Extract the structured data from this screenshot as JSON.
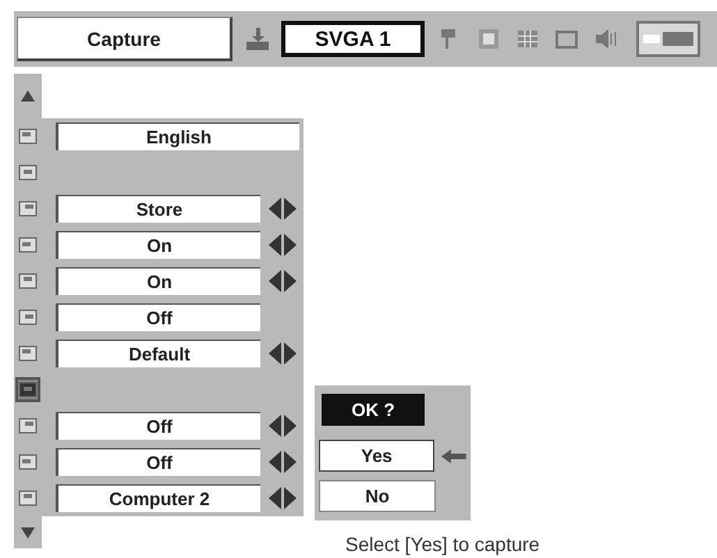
{
  "toolbar": {
    "title": "Capture",
    "source": "SVGA 1"
  },
  "menu": {
    "rows": [
      {
        "value": "English",
        "arrows": false,
        "wide": true,
        "selected": false
      },
      {
        "selected": false
      },
      {
        "value": "Store",
        "arrows": true,
        "selected": false
      },
      {
        "value": "On",
        "arrows": true,
        "selected": false
      },
      {
        "value": "On",
        "arrows": true,
        "selected": false
      },
      {
        "value": "Off",
        "arrows": false,
        "selected": false
      },
      {
        "value": "Default",
        "arrows": true,
        "selected": false
      },
      {
        "selected": true
      },
      {
        "value": "Off",
        "arrows": true,
        "selected": false
      },
      {
        "value": "Off",
        "arrows": true,
        "selected": false
      },
      {
        "value": "Computer 2",
        "arrows": true,
        "selected": false
      }
    ]
  },
  "dialog": {
    "title": "OK ?",
    "options": [
      {
        "label": "Yes",
        "selected": true
      },
      {
        "label": "No",
        "selected": false
      }
    ]
  },
  "caption": "Select [Yes] to capture"
}
